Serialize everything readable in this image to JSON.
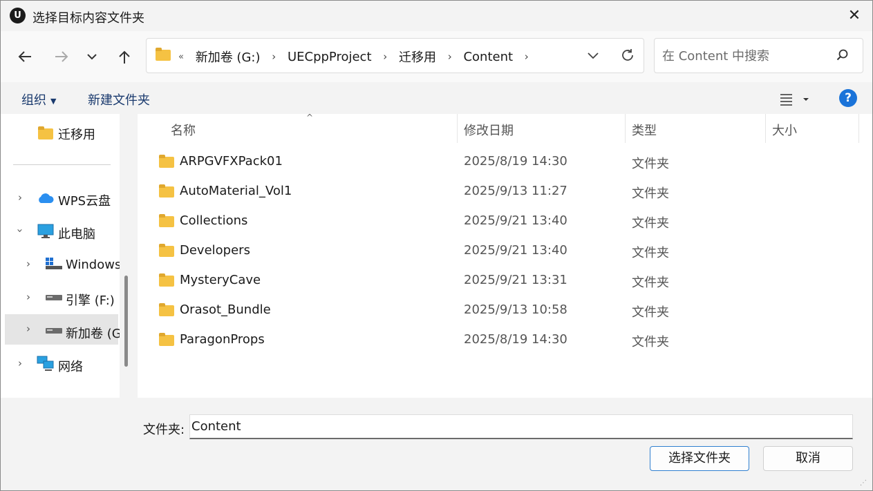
{
  "window": {
    "title": "选择目标内容文件夹",
    "app_logo": "U"
  },
  "nav": {
    "back_icon": "back-arrow-icon",
    "forward_icon": "forward-arrow-icon",
    "recent_icon": "chevron-down-icon",
    "up_icon": "up-arrow-icon"
  },
  "address": {
    "overflow": "«",
    "crumbs": [
      "新加卷 (G:)",
      "UECppProject",
      "迁移用",
      "Content"
    ]
  },
  "search": {
    "placeholder": "在 Content 中搜索"
  },
  "toolbar": {
    "organize_label": "组织",
    "new_folder_label": "新建文件夹",
    "help_label": "?"
  },
  "sidebar": {
    "items": [
      {
        "label": "迁移用",
        "icon": "folder-icon"
      },
      {
        "label": "WPS云盘",
        "icon": "cloud-icon"
      },
      {
        "label": "此电脑",
        "icon": "computer-icon"
      },
      {
        "label": "Windows",
        "icon": "windows-drive-icon"
      },
      {
        "label": "引擎 (F:)",
        "icon": "drive-icon"
      },
      {
        "label": "新加卷 (G",
        "icon": "drive-icon"
      },
      {
        "label": "网络",
        "icon": "network-icon"
      }
    ]
  },
  "columns": {
    "name": "名称",
    "date": "修改日期",
    "type": "类型",
    "size": "大小"
  },
  "files": [
    {
      "name": "ARPGVFXPack01",
      "date": "2025/8/19 14:30",
      "type": "文件夹"
    },
    {
      "name": "AutoMaterial_Vol1",
      "date": "2025/9/13 11:27",
      "type": "文件夹"
    },
    {
      "name": "Collections",
      "date": "2025/9/21 13:40",
      "type": "文件夹"
    },
    {
      "name": "Developers",
      "date": "2025/9/21 13:40",
      "type": "文件夹"
    },
    {
      "name": "MysteryCave",
      "date": "2025/9/21 13:31",
      "type": "文件夹"
    },
    {
      "name": "Orasot_Bundle",
      "date": "2025/9/13 10:58",
      "type": "文件夹"
    },
    {
      "name": "ParagonProps",
      "date": "2025/8/19 14:30",
      "type": "文件夹"
    }
  ],
  "footer": {
    "folder_label": "文件夹:",
    "folder_value": "Content",
    "select_label": "选择文件夹",
    "cancel_label": "取消"
  },
  "colors": {
    "accent": "#1a73d9",
    "folder": "#f5c243",
    "primary_border": "#2f7fd0"
  }
}
